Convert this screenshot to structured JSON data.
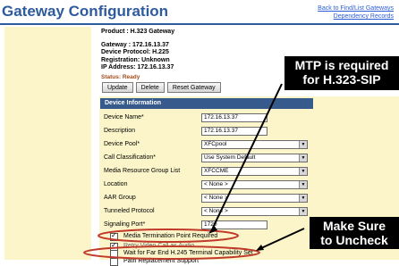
{
  "page": {
    "title": "Gateway Configuration"
  },
  "links": {
    "back": "Back to Find/List Gateways",
    "dependency": "Dependency Records"
  },
  "info": {
    "product": "Product : H.323 Gateway",
    "gateway": "Gateway : 172.16.13.37",
    "protocol": "Device Protocol: H.225",
    "registration": "Registration:  Unknown",
    "ip": "IP Address:  172.16.13.37"
  },
  "status": "Status: Ready",
  "buttons": {
    "update": "Update",
    "delete": "Delete",
    "reset": "Reset Gateway"
  },
  "section": {
    "device_info": "Device Information"
  },
  "fields": [
    {
      "label": "Device Name*",
      "value": "172.16.13.37",
      "kind": "input"
    },
    {
      "label": "Description",
      "value": "172.16.13.37",
      "kind": "input"
    },
    {
      "label": "Device Pool*",
      "value": "XFCpool",
      "kind": "select"
    },
    {
      "label": "Call Classification*",
      "value": "Use System Default",
      "kind": "select"
    },
    {
      "label": "Media Resource Group List",
      "value": "XFCCME",
      "kind": "select"
    },
    {
      "label": "Location",
      "value": "< None >",
      "kind": "select"
    },
    {
      "label": "AAR Group",
      "value": "< None >",
      "kind": "select"
    },
    {
      "label": "Tunneled Protocol",
      "value": "< None >",
      "kind": "select"
    },
    {
      "label": "Signaling Port*",
      "value": "1720",
      "kind": "input"
    }
  ],
  "checkboxes": [
    {
      "label": "Media Termination Point Required",
      "checked": true
    },
    {
      "label": "Retry Video Call as Audio",
      "checked": true
    },
    {
      "label": "Wait for Far End H.245 Terminal Capability Set",
      "checked": false
    },
    {
      "label": "Path Replacement Support",
      "checked": false
    }
  ],
  "callouts": {
    "mtp_line1": "MTP is required",
    "mtp_line2": "for H.323-SIP",
    "uncheck_line1": "Make Sure",
    "uncheck_line2": "to Uncheck"
  },
  "colors": {
    "title": "#2e5a9e",
    "header": "#365a8c",
    "panel": "#fbf5c9",
    "annotation": "#c0392b"
  }
}
